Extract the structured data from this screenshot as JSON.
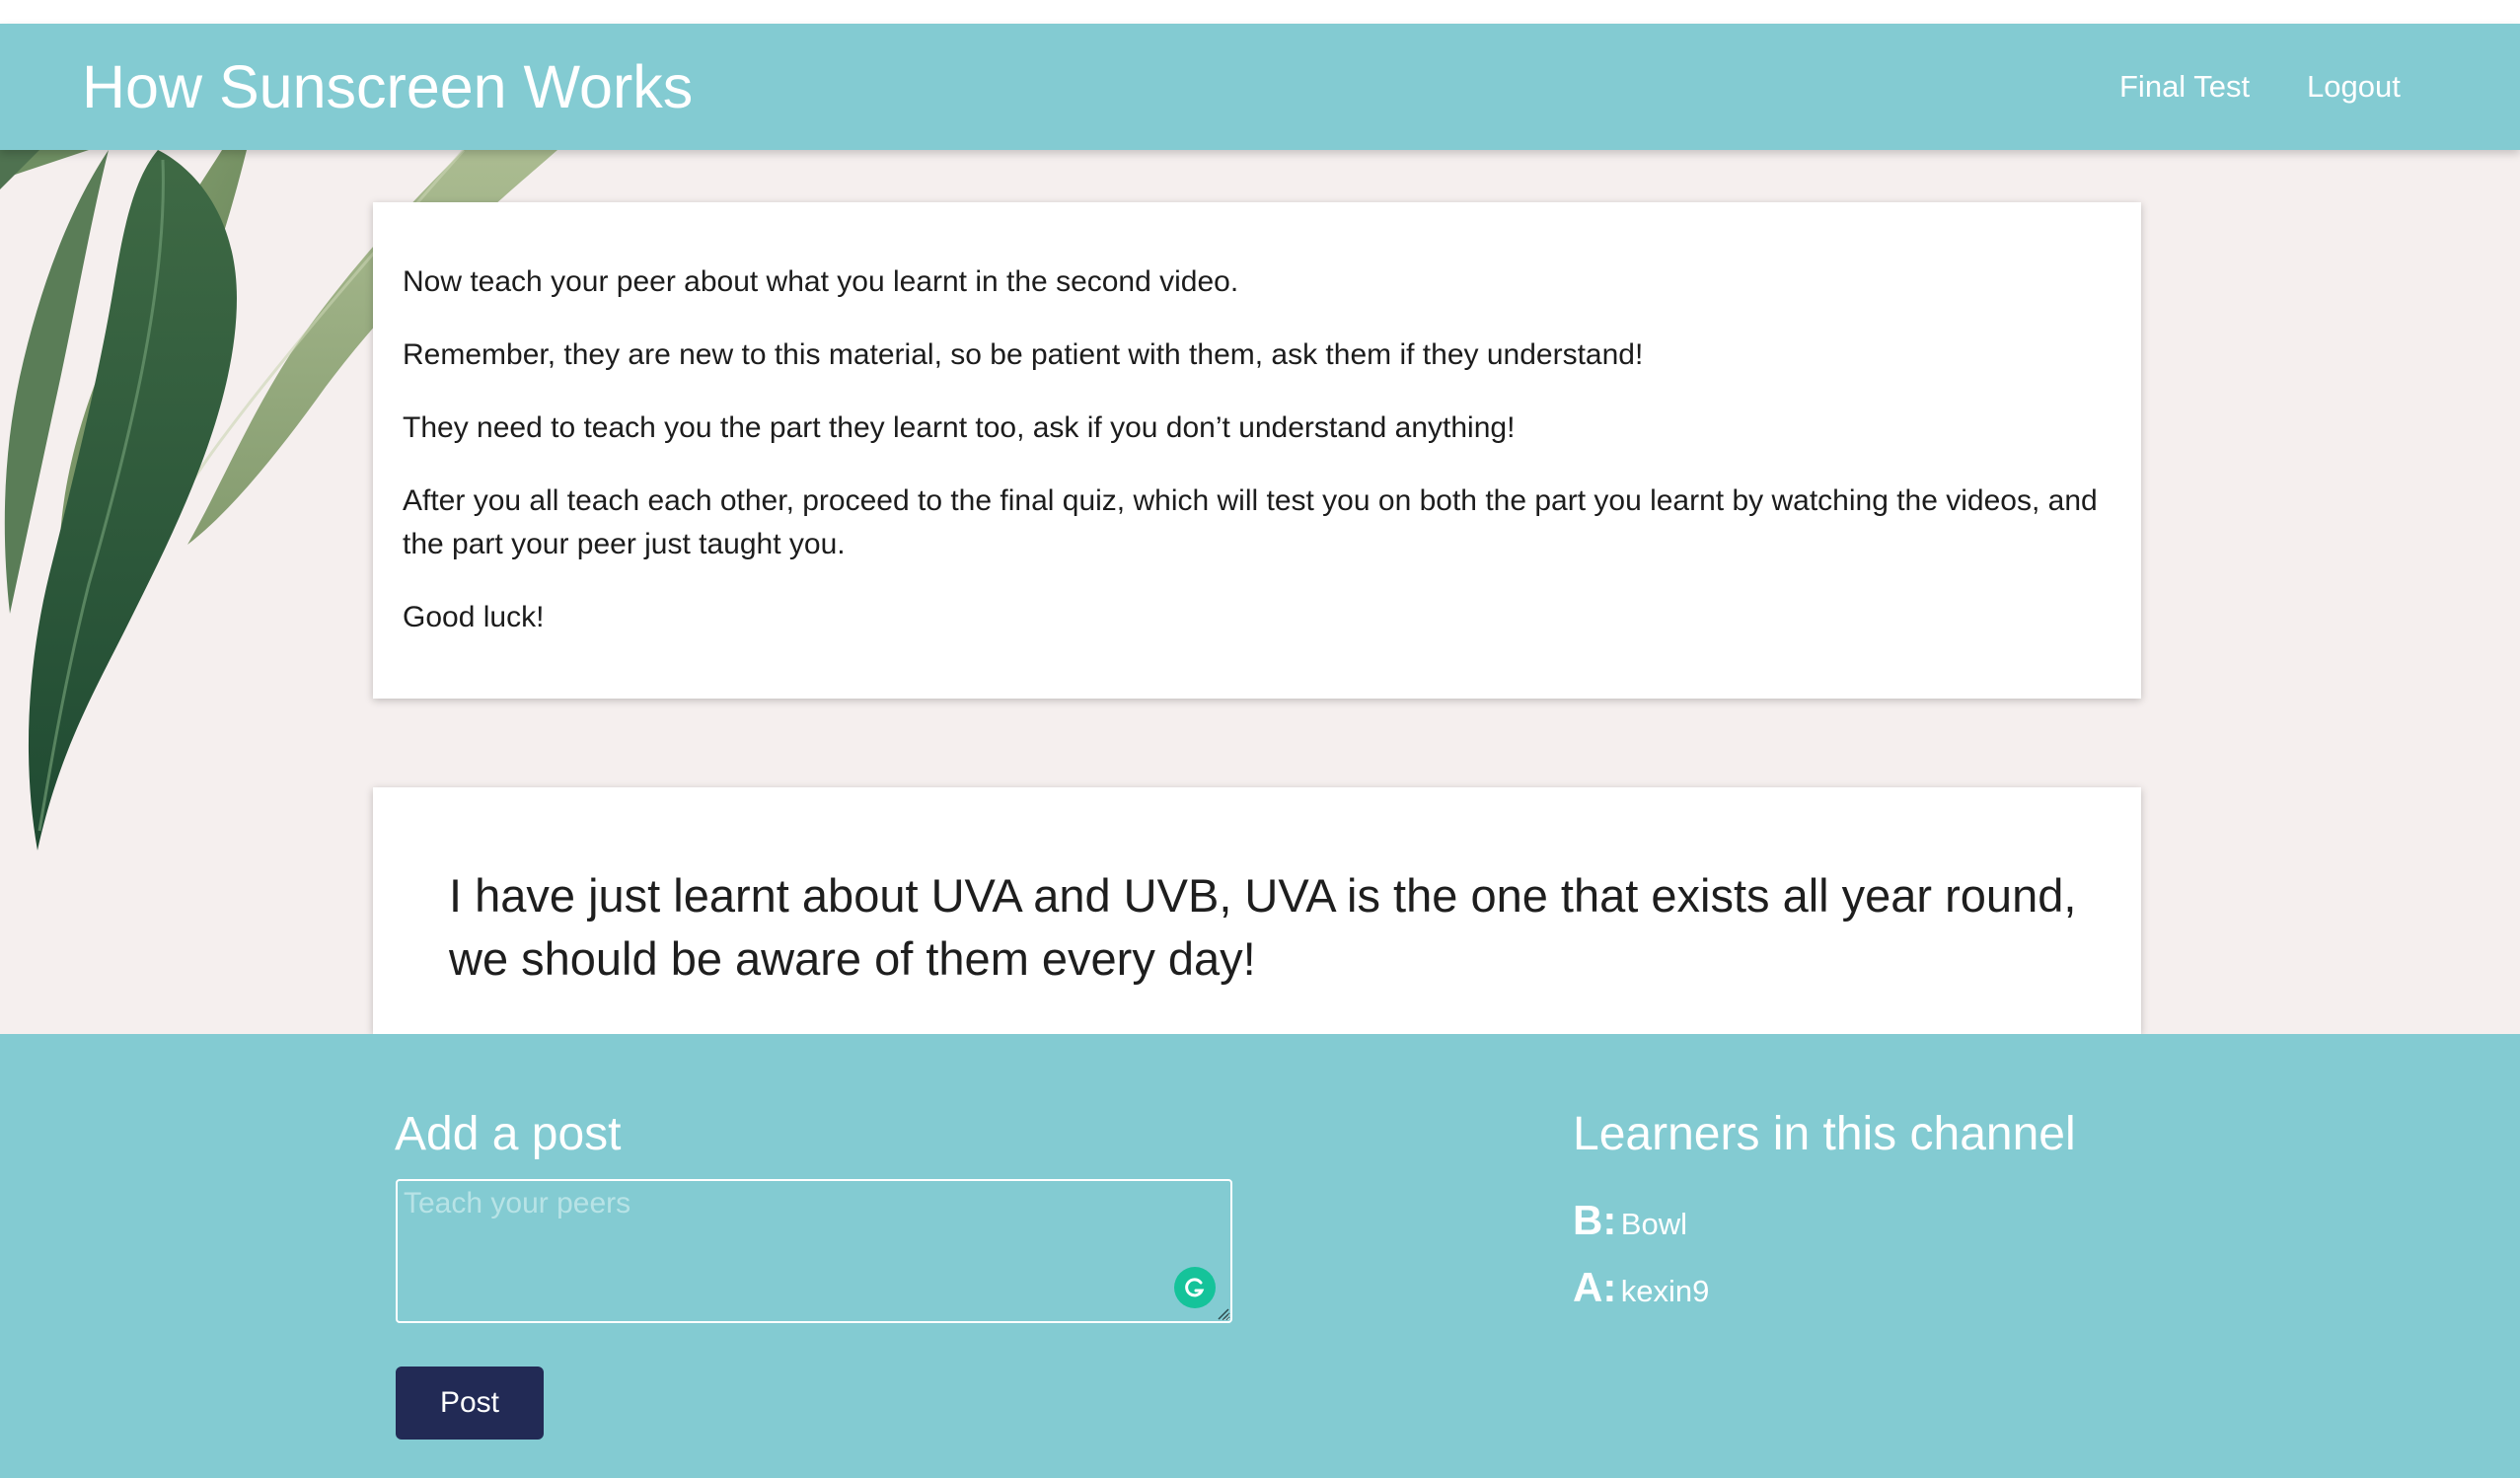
{
  "header": {
    "title": "How Sunscreen Works",
    "nav": [
      "Final Test",
      "Logout"
    ]
  },
  "instructions": {
    "paragraphs": [
      "Now teach your peer about what you learnt in the second video.",
      "Remember, they are new to this material, so be patient with them, ask them if they understand!",
      "They need to teach you the part they learnt too, ask if you don’t understand anything!",
      "After you all teach each other, proceed to the final quiz, which will test you on both the part you learnt by watching the videos, and the part your peer just taught you.",
      "Good luck!"
    ]
  },
  "posts": [
    {
      "text": "I have just learnt about UVA and UVB, UVA is the one that exists all year round, we should be aware of them every day!"
    }
  ],
  "add_post": {
    "title": "Add a post",
    "placeholder": "Teach your peers",
    "button_label": "Post"
  },
  "learners": {
    "title": "Learners in this channel",
    "list": [
      {
        "role": "B:",
        "name": "Bowl"
      },
      {
        "role": "A:",
        "name": "kexin9"
      }
    ]
  },
  "colors": {
    "navbar": "#83cbd2",
    "footer": "#83cbd2",
    "page_bg": "#f5efee",
    "post_button": "#222a55",
    "grammarly": "#15c39a"
  },
  "icons": {
    "leaf": "leaf-decoration",
    "grammarly": "grammarly-icon",
    "resize": "resize-grip-icon"
  }
}
